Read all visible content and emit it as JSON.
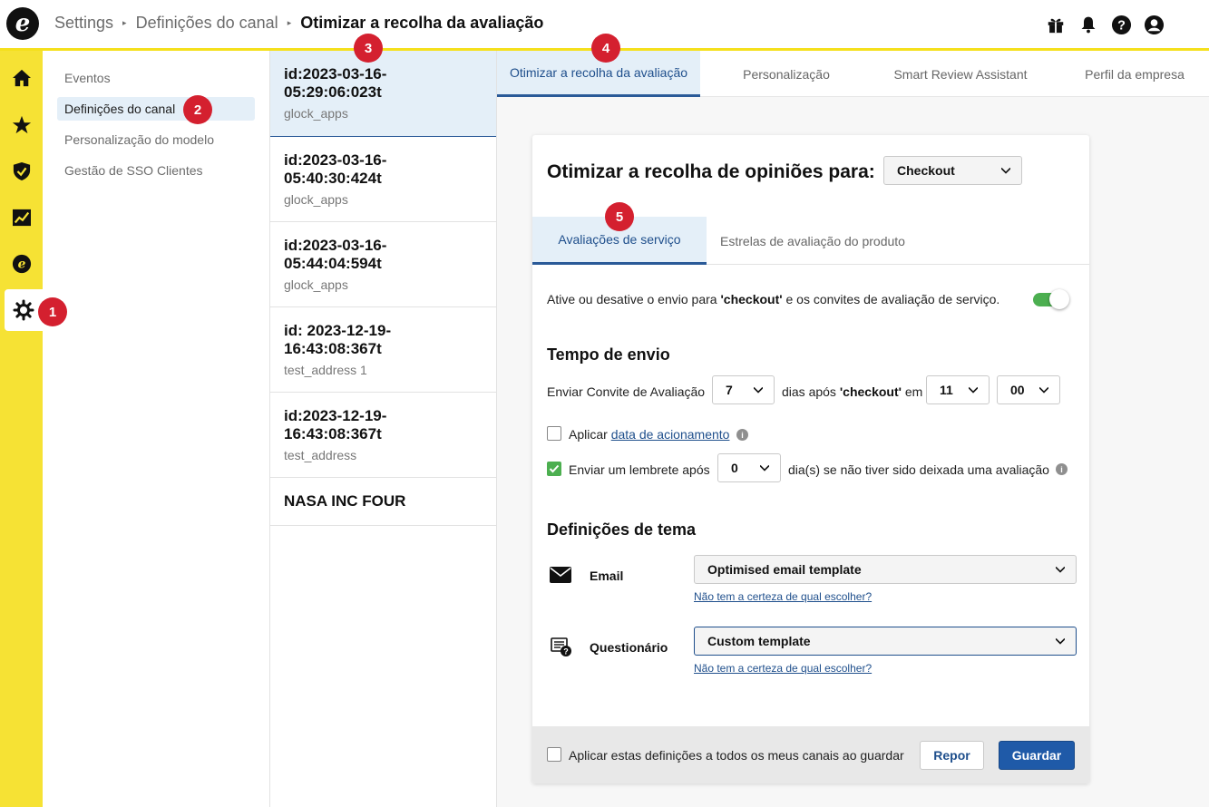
{
  "app": {
    "logo_letter": "e"
  },
  "breadcrumb": {
    "items": [
      "Settings",
      "Definições do canal"
    ],
    "current": "Otimizar a recolha da avaliação",
    "separator": "▸"
  },
  "top_icons": [
    "gift-icon",
    "bell-icon",
    "help-icon",
    "user-icon"
  ],
  "rail": {
    "items": [
      "home-icon",
      "star-icon",
      "shield-check-icon",
      "analytics-icon",
      "e-circle-icon",
      "gear-icon"
    ],
    "active": "gear-icon"
  },
  "badges": [
    "1",
    "2",
    "3",
    "4",
    "5"
  ],
  "settings_nav": {
    "items": [
      "Eventos",
      "Definições do canal",
      "Personalização do modelo",
      "Gestão de SSO Clientes"
    ],
    "selected": "Definições do canal"
  },
  "channel_list": [
    {
      "title": "id:2023-03-16-05:29:06:023t",
      "sub": "glock_apps"
    },
    {
      "title": "id:2023-03-16-05:40:30:424t",
      "sub": "glock_apps"
    },
    {
      "title": "id:2023-03-16-05:44:04:594t",
      "sub": "glock_apps"
    },
    {
      "title": "id: 2023-12-19-16:43:08:367t",
      "sub": "test_address 1"
    },
    {
      "title": "id:2023-12-19-16:43:08:367t",
      "sub": "test_address"
    },
    {
      "title": "NASA INC FOUR",
      "sub": ""
    }
  ],
  "main_tabs": [
    "Otimizar a recolha da avaliação",
    "Personalização",
    "Smart Review Assistant",
    "Perfil da empresa"
  ],
  "card": {
    "title": "Otimizar a recolha de opiniões para:",
    "optimise_select": "Checkout",
    "subtabs": [
      "Avaliações de serviço",
      "Estrelas de avaliação do produto"
    ],
    "toggle_text_pre": "Ative ou desative o envio para ",
    "toggle_text_bold": "'checkout'",
    "toggle_text_post": " e os convites de avaliação de serviço.",
    "toggle_on": true,
    "send_time": {
      "heading": "Tempo de envio",
      "label": "Enviar Convite de Avaliação",
      "days_value": "7",
      "days_after_pre": "dias após ",
      "days_after_bold": "'checkout'",
      "days_after_post": " em",
      "hour_value": "11",
      "minute_value": "00",
      "trigger_pre": "Aplicar ",
      "trigger_link": "data de acionamento",
      "trigger_checked": false,
      "reminder_label": "Enviar um lembrete após",
      "reminder_value": "0",
      "reminder_suffix": "dia(s) se não tiver sido deixada uma avaliação",
      "reminder_checked": true
    },
    "theme": {
      "heading": "Definições de tema",
      "email_label": "Email",
      "email_template": "Optimised email template",
      "questionnaire_label": "Questionário",
      "questionnaire_template": "Custom template",
      "help_link": "Não tem a certeza de qual escolher?"
    },
    "footer": {
      "apply_all": "Aplicar estas definições a todos os meus canais ao guardar",
      "reset": "Repor",
      "save": "Guardar"
    }
  },
  "colors": {
    "accent_yellow": "#f6e234",
    "primary_blue": "#1f5aa8",
    "selected_bg": "#e4eff8",
    "badge_red": "#d4202f",
    "toggle_green": "#4caf50"
  }
}
